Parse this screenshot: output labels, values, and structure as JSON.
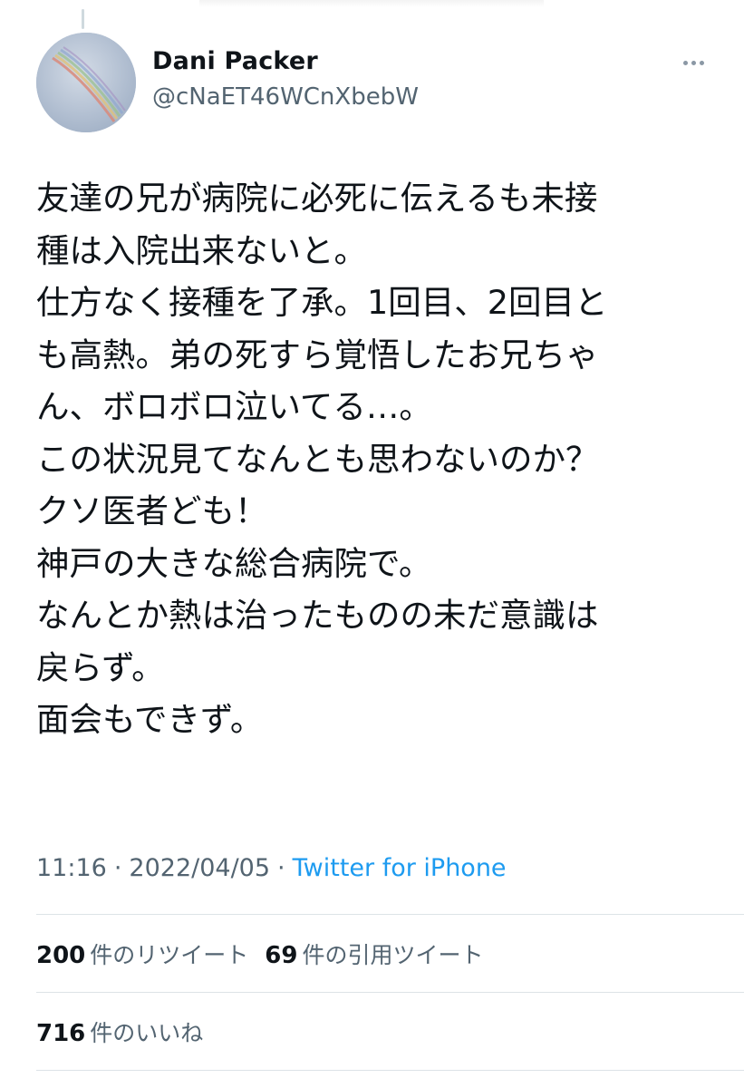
{
  "author": {
    "name": "Dani Packer",
    "handle": "@cNaET46WCnXbebW"
  },
  "tweet": {
    "lines": [
      "友達の兄が病院に必死に伝えるも未接",
      "種は入院出来ないと。",
      "仕方なく接種を了承。1回目、2回目と",
      "も高熱。弟の死すら覚悟したお兄ちゃ",
      "ん、ボロボロ泣いてる…。",
      "この状況見てなんとも思わないのか？",
      "クソ医者ども！",
      "神戸の大きな総合病院で。",
      "なんとか熱は治ったものの未だ意識は",
      "戻らず。",
      "面会もできず。"
    ]
  },
  "meta": {
    "time": "11:16",
    "separator": "·",
    "date": "2022/04/05",
    "source": "Twitter for iPhone"
  },
  "stats": {
    "retweets_count": "200",
    "retweets_label": "件のリツイート",
    "quotes_count": "69",
    "quotes_label": "件の引用ツイート",
    "likes_count": "716",
    "likes_label": "件のいいね"
  },
  "icons": {
    "more": "more-dots-icon",
    "avatar_image": "rainbow-sky"
  },
  "colors": {
    "text": "#0f1419",
    "secondary": "#536471",
    "link": "#1d9bf0"
  }
}
